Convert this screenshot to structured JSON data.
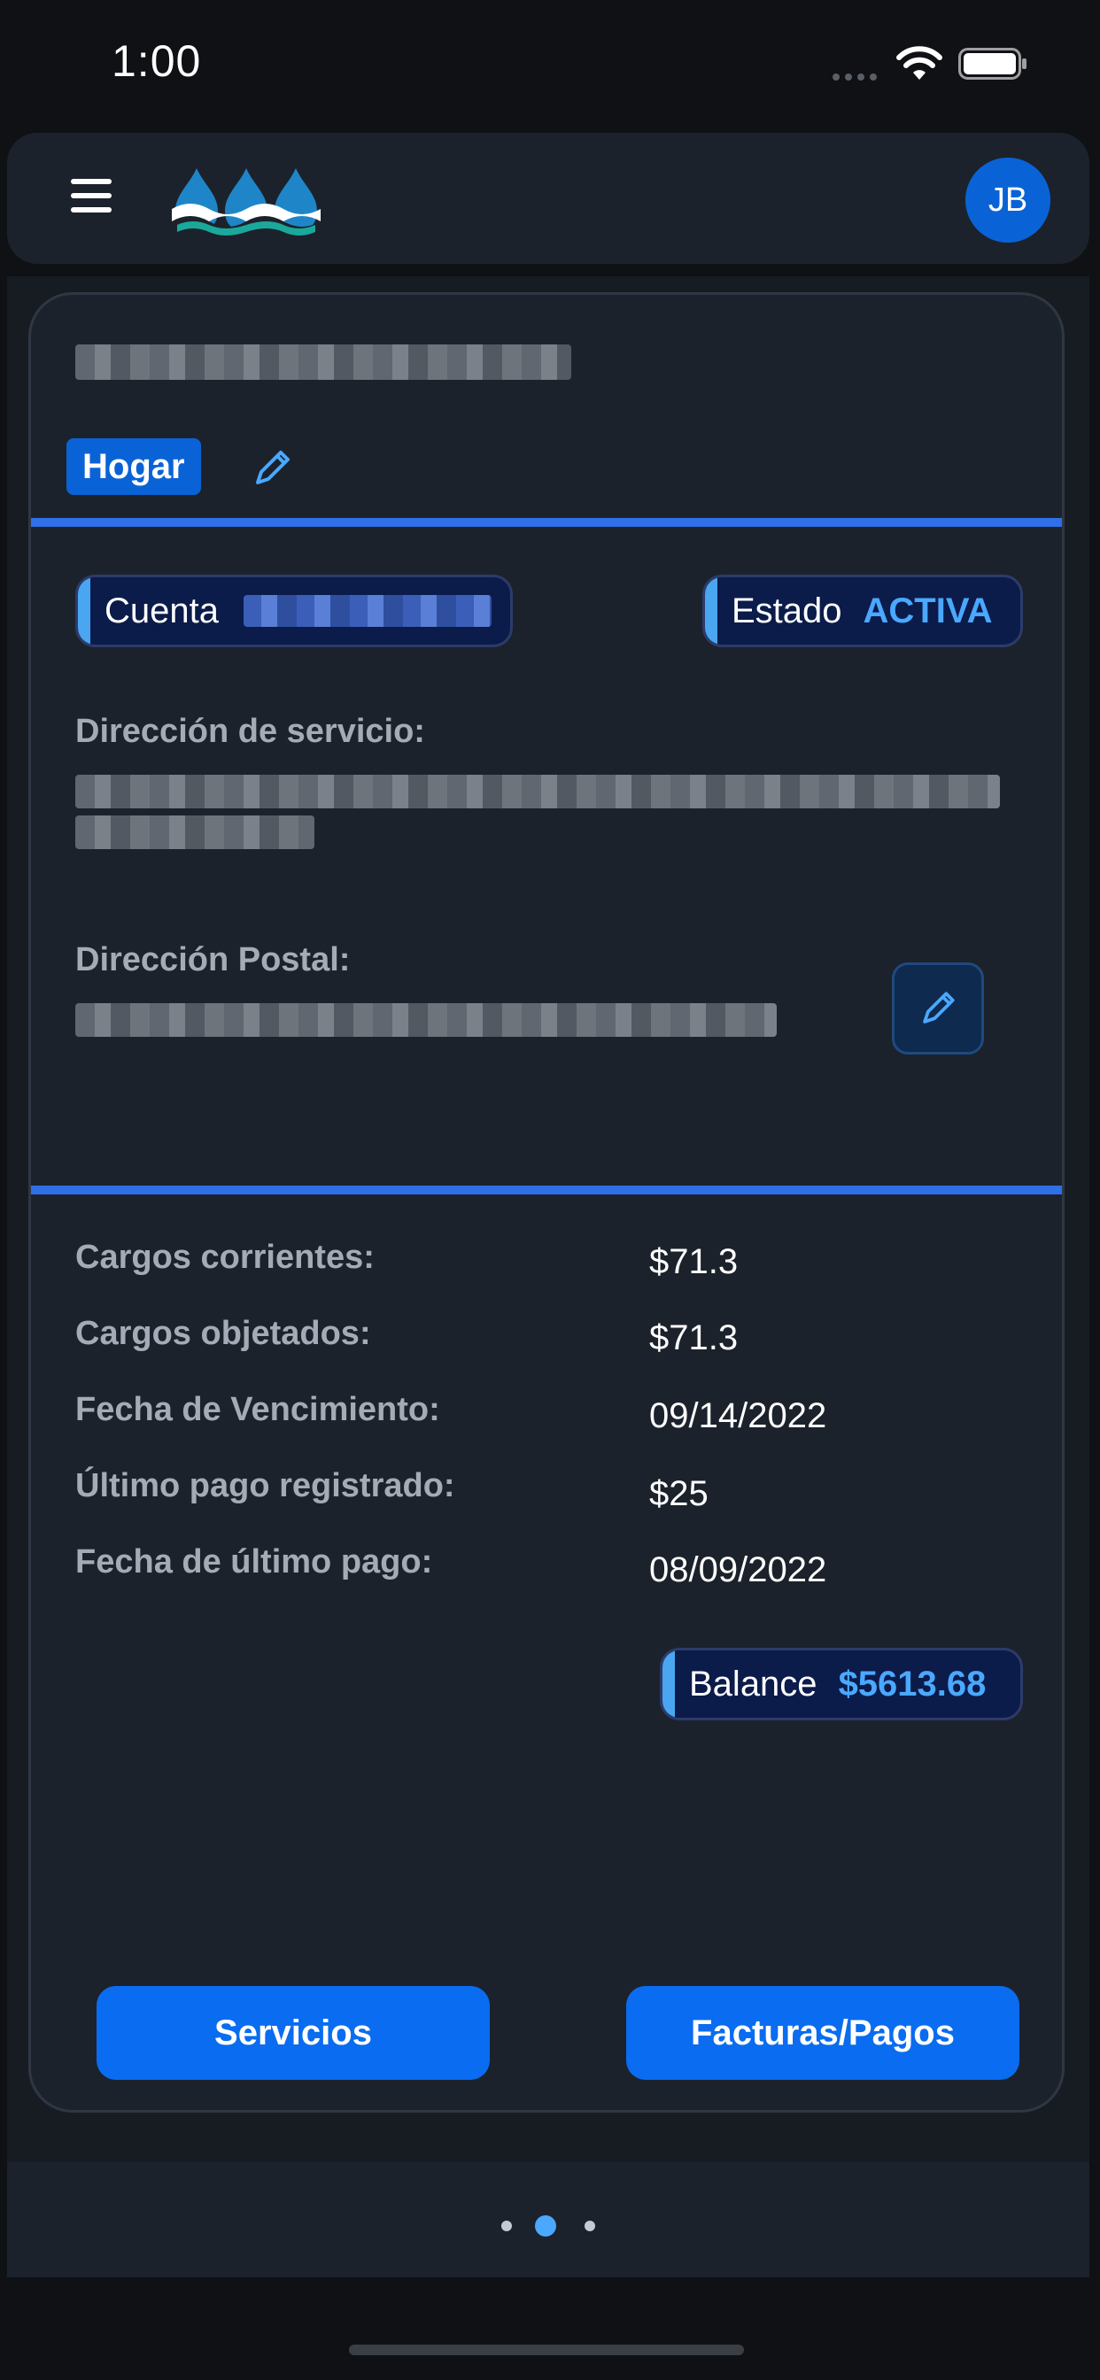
{
  "status_bar": {
    "time": "1:00"
  },
  "header": {
    "avatar_initials": "JB"
  },
  "account": {
    "tag": "Hogar",
    "account_label": "Cuenta",
    "status_label": "Estado",
    "status_value": "ACTIVA",
    "service_address_label": "Dirección de servicio:",
    "postal_address_label": "Dirección Postal:"
  },
  "details": {
    "items": [
      {
        "label": "Cargos corrientes:",
        "value": "$71.3"
      },
      {
        "label": "Cargos objetados:",
        "value": "$71.3"
      },
      {
        "label": "Fecha de Vencimiento:",
        "value": "09/14/2022"
      },
      {
        "label": "Último pago registrado:",
        "value": "$25"
      },
      {
        "label": "Fecha de último pago:",
        "value": "08/09/2022"
      }
    ],
    "balance_label": "Balance",
    "balance_value": "$5613.68"
  },
  "actions": {
    "services_label": "Servicios",
    "bills_label": "Facturas/Pagos"
  },
  "pager": {
    "pages": 3,
    "active_page": 2
  },
  "colors": {
    "accent": "#0a6cf0",
    "divider": "#2f6fe8",
    "status_active": "#4aa8ff",
    "background": "#0f1115",
    "card": "#1c222b"
  },
  "icons": [
    "menu-icon",
    "logo-waves",
    "pencil-icon",
    "wifi-icon",
    "battery-icon"
  ]
}
